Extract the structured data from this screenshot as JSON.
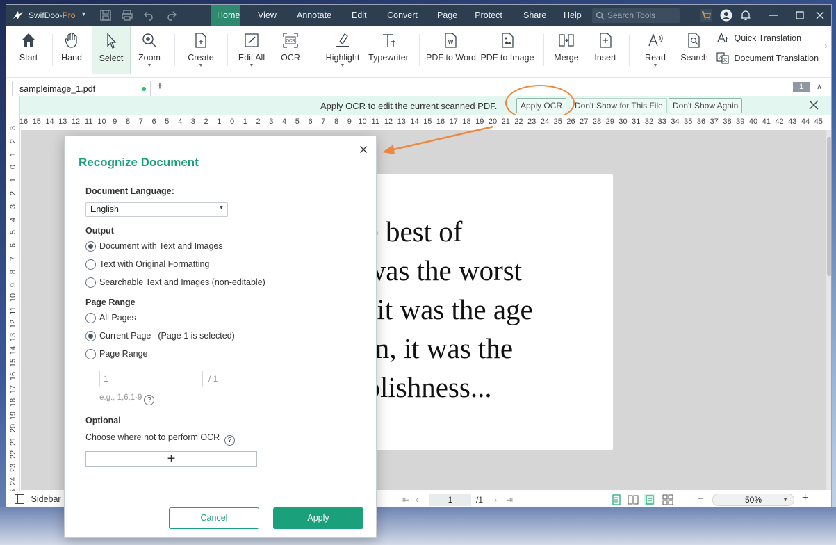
{
  "app": {
    "name": "SwifDoo-",
    "edition": "Pro"
  },
  "menu": {
    "items": [
      "Home",
      "View",
      "Annotate",
      "Edit",
      "Convert",
      "Page",
      "Protect",
      "Share",
      "Help"
    ],
    "active": "Home",
    "search_placeholder": "Search Tools"
  },
  "ribbon": {
    "start": "Start",
    "hand": "Hand",
    "select": "Select",
    "zoom": "Zoom",
    "create": "Create",
    "edit_all": "Edit All",
    "ocr": "OCR",
    "highlight": "Highlight",
    "typewriter": "Typewriter",
    "pdf_to_word": "PDF to Word",
    "pdf_to_image": "PDF to Image",
    "merge": "Merge",
    "insert": "Insert",
    "read": "Read",
    "search": "Search",
    "quick_translation": "Quick Translation",
    "document_translation": "Document Translation"
  },
  "tabs": {
    "doc_name": "sampleimage_1.pdf",
    "page_count_badge": "1"
  },
  "banner": {
    "message": "Apply OCR to edit the current scanned PDF.",
    "apply_ocr": "Apply OCR",
    "dont_show_file": "Don't Show for This File",
    "dont_show_again": "Don't Show Again"
  },
  "rulers": {
    "horizontal": [
      "16",
      "15",
      "14",
      "13",
      "12",
      "11",
      "10",
      "9",
      "8",
      "7",
      "6",
      "5",
      "4",
      "3",
      "2",
      "1",
      "0",
      "1",
      "2",
      "3",
      "4",
      "5",
      "6",
      "7",
      "8",
      "9",
      "10",
      "11",
      "12",
      "13",
      "14",
      "15",
      "16",
      "17",
      "18",
      "19",
      "20",
      "21",
      "22",
      "23",
      "24",
      "25",
      "26",
      "27",
      "28",
      "29",
      "30",
      "31",
      "32",
      "33",
      "34",
      "35",
      "36",
      "37",
      "38",
      "39",
      "40",
      "41",
      "42",
      "43",
      "44",
      "45"
    ],
    "vertical": [
      "3",
      "2",
      "1",
      "0",
      "1",
      "2",
      "3",
      "4",
      "5",
      "6",
      "7",
      "8",
      "9",
      "10",
      "11",
      "12",
      "13",
      "14",
      "15",
      "16",
      "17",
      "18",
      "19",
      "20",
      "21",
      "22",
      "23",
      "24",
      "25"
    ]
  },
  "pdf_content": {
    "lines": [
      "he best of",
      "t was the worst",
      "s, it was the age",
      "om, it was the",
      "oolishness..."
    ]
  },
  "status": {
    "sidebar": "Sidebar",
    "current_page": "1",
    "total_pages": "/1",
    "zoom": "50%"
  },
  "dialog": {
    "title": "Recognize Document",
    "language_label": "Document Language:",
    "language_value": "English",
    "output_label": "Output",
    "output_options": [
      "Document with Text and Images",
      "Text with Original Formatting",
      "Searchable Text and Images (non-editable)"
    ],
    "page_range_label": "Page Range",
    "page_options": [
      "All Pages",
      "Current Page",
      "Page Range"
    ],
    "current_page_note": "(Page 1 is selected)",
    "range_value": "1",
    "range_total": "/ 1",
    "range_hint": "e.g., 1,6,1-9",
    "optional_label": "Optional",
    "exclude_text": "Choose where not to perform OCR",
    "cancel": "Cancel",
    "apply": "Apply"
  },
  "colors": {
    "accent": "#1aa07a",
    "titlebar": "#2c3e4f",
    "highlight": "#f0873a"
  }
}
